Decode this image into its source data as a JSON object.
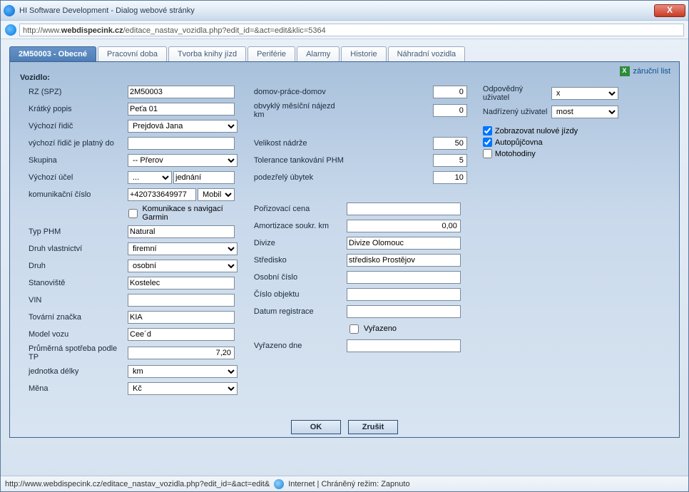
{
  "window": {
    "title": "HI Software Development - Dialog webové stránky",
    "url_pre": "http://www.",
    "url_bold": "webdispecink.cz",
    "url_post": "/editace_nastav_vozidla.php?edit_id=&act=edit&klic=5364",
    "close": "X"
  },
  "tabs": {
    "t0": "2M50003 - Obecné",
    "t1": "Pracovní doba",
    "t2": "Tvorba knihy jízd",
    "t3": "Periférie",
    "t4": "Alarmy",
    "t5": "Historie",
    "t6": "Náhradní vozidla"
  },
  "links": {
    "warranty": "záruční list"
  },
  "section": {
    "vehicle": "Vozidlo:"
  },
  "col1": {
    "rz_label": "RZ (SPZ)",
    "rz": "2M50003",
    "short_label": "Krátký popis",
    "short": "Peťa 01",
    "driver_label": "Výchozí řidič",
    "driver": "Prejdová Jana",
    "driver_until_label": "výchozí řidič je platný do",
    "driver_until": "",
    "group_label": "Skupina",
    "group": "-- Přerov",
    "purpose_label": "Výchozí účel",
    "purpose_sel": "...",
    "purpose_txt": "jednání",
    "comm_label": "komunikační číslo",
    "comm": "+420733649977",
    "comm_sel": "Mobil",
    "garmin_label": "Komunikace s navigací Garmin",
    "phm_label": "Typ PHM",
    "phm": "Natural",
    "owner_label": "Druh vlastnictví",
    "owner": "firemní",
    "kind_label": "Druh",
    "kind": "osobní",
    "station_label": "Stanoviště",
    "station": "Kostelec",
    "vin_label": "VIN",
    "vin": "",
    "brand_label": "Tovární značka",
    "brand": "KIA",
    "model_label": "Model vozu",
    "model": "Cee´d",
    "cons_label": "Průměrná spotřeba podle TP",
    "cons": "7,20",
    "unit_label": "jednotka délky",
    "unit": "km",
    "currency_label": "Měna",
    "currency": "Kč"
  },
  "col2": {
    "hwh_label": "domov-práce-domov",
    "hwh": "0",
    "monthly_label": "obvyklý měsíční nájezd km",
    "monthly": "0",
    "tank_label": "Velikost nádrže",
    "tank": "50",
    "tol_label": "Tolerance tankování PHM",
    "tol": "5",
    "susp_label": "podezřelý úbytek",
    "susp": "10",
    "price_label": "Pořizovací cena",
    "price": "",
    "amort_label": "Amortizace soukr. km",
    "amort": "0,00",
    "div_label": "Divize",
    "div": "Divize Olomouc",
    "center_label": "Středisko",
    "center": "středisko Prostějov",
    "pnum_label": "Osobní číslo",
    "pnum": "",
    "objnum_label": "Číslo objektu",
    "objnum": "",
    "reg_label": "Datum registrace",
    "reg": "",
    "discard_label": "Vyřazeno",
    "discard_date_label": "Vyřazeno dne",
    "discard_date": ""
  },
  "col3": {
    "resp_label": "Odpovědný uživatel",
    "resp": "x",
    "sup_label": "Nadřízený uživatel",
    "sup": "most",
    "chk1": "Zobrazovat nulové jízdy",
    "chk2": "Autopůjčovna",
    "chk3": "Motohodiny"
  },
  "buttons": {
    "ok": "OK",
    "cancel": "Zrušit"
  },
  "status": {
    "left": "http://www.webdispecink.cz/editace_nastav_vozidla.php?edit_id=&act=edit&",
    "right": "Internet | Chráněný režim: Zapnuto"
  }
}
